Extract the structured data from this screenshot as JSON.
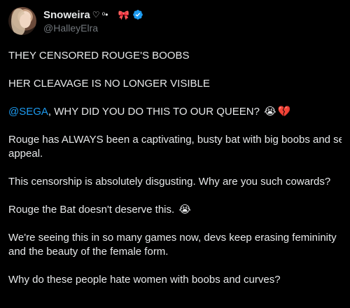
{
  "author": {
    "display_name": "Snoweira",
    "name_symbols": "♡ ᵒ•",
    "bow_emoji": "🎀",
    "handle": "@HalleyElra",
    "verified": true,
    "verified_color": "#1d9bf0"
  },
  "tweet": {
    "p1": "THEY CENSORED ROUGE'S BOOBS",
    "p2": "HER CLEAVAGE IS NO LONGER VISIBLE",
    "p3_mention": "@SEGA",
    "p3_text": ", WHY DID YOU DO THIS TO OUR QUEEN? ",
    "p3_emoji_1": "😭",
    "p3_emoji_2": "💔",
    "p4_line1": "Rouge has ALWAYS been a captivating, busty bat with big boobs and sex",
    "p4_line2": "appeal.",
    "p5": "This censorship is absolutely disgusting. Why are you such cowards?",
    "p6_text": "Rouge the Bat doesn't deserve this. ",
    "p6_emoji": "😭",
    "p7_line1": "We're seeing this in so many games now, devs keep erasing femininity",
    "p7_line2": "and the beauty of the female form.",
    "p8": "Why do these people hate women with boobs and curves?"
  },
  "colors": {
    "background": "#000000",
    "text": "#e7e9ea",
    "secondary": "#71767b",
    "link": "#1d9bf0"
  }
}
